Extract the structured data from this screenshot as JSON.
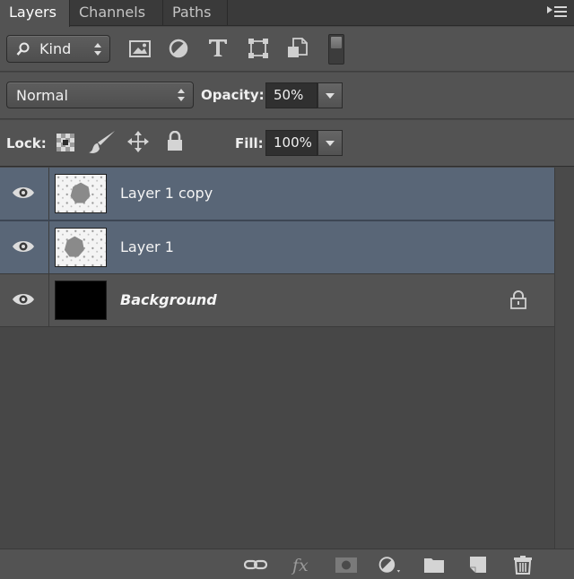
{
  "tabs": [
    {
      "label": "Layers",
      "active": true
    },
    {
      "label": "Channels",
      "active": false
    },
    {
      "label": "Paths",
      "active": false
    }
  ],
  "filter": {
    "kind_label": "Kind",
    "icons": [
      "image-filter-icon",
      "adjustment-filter-icon",
      "type-filter-icon",
      "shape-filter-icon",
      "smart-object-filter-icon",
      "filter-toggle-icon"
    ]
  },
  "blend": {
    "mode": "Normal",
    "opacity_label": "Opacity:",
    "opacity_value": "50%"
  },
  "lock": {
    "label": "Lock:",
    "fill_label": "Fill:",
    "fill_value": "100%"
  },
  "layers": [
    {
      "name": "Layer 1 copy",
      "selected": true,
      "visible": true
    },
    {
      "name": "Layer 1",
      "selected": true,
      "visible": true
    },
    {
      "name": "Background",
      "selected": false,
      "visible": true,
      "locked": true
    }
  ],
  "colors": {
    "selected_row": "#596677",
    "panel_bg": "#535353",
    "canvas_bg": "#474747"
  },
  "footer_icons": [
    "link-layers-icon",
    "layer-style-fx-icon",
    "layer-mask-icon",
    "adjustment-layer-icon",
    "new-group-icon",
    "new-layer-icon",
    "delete-layer-icon"
  ]
}
